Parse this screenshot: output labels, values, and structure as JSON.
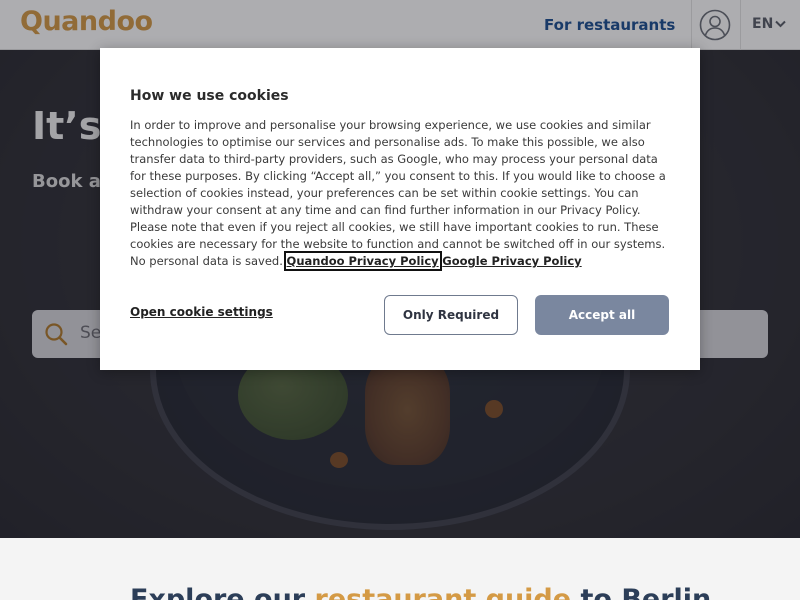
{
  "header": {
    "logo": "Quandoo",
    "for_restaurants": "For restaurants",
    "language": "EN",
    "user_icon": "user-circle-icon",
    "lang_icon": "chevron-down-icon"
  },
  "hero": {
    "title": "It’s",
    "subtitle": "Book a",
    "search_placeholder": "Se",
    "search_icon": "search-icon"
  },
  "cookie_banner": {
    "title": "How we use cookies",
    "body": "In order to improve and personalise your browsing experience, we use cookies and similar technologies to optimise our services and personalise ads. To make this possible, we also transfer data to third-party providers, such as Google, who may process your personal data for these purposes. By clicking “Accept all,” you consent to this. If you would like to choose a selection of cookies instead, your preferences can be set within cookie settings. You can withdraw your consent at any time and can find further information in our Privacy Policy. Please note that even if you reject all cookies, we still have important cookies to run. These cookies are necessary for the website to function and cannot be switched off in our systems. No personal data is saved.",
    "quandoo_policy_link": "Quandoo Privacy Policy",
    "google_policy_link": "Google Privacy Policy",
    "settings_link": "Open cookie settings",
    "only_required_button": "Only Required",
    "accept_all_button": "Accept all"
  },
  "explore": {
    "title_start": "Explore our ",
    "title_highlight": "restaurant guide",
    "title_end": " to Berlin"
  },
  "colors": {
    "brand": "#d49a45",
    "link_blue": "#1d4f91",
    "accept_button": "#7a879f",
    "heading_navy": "#2c3e58"
  }
}
